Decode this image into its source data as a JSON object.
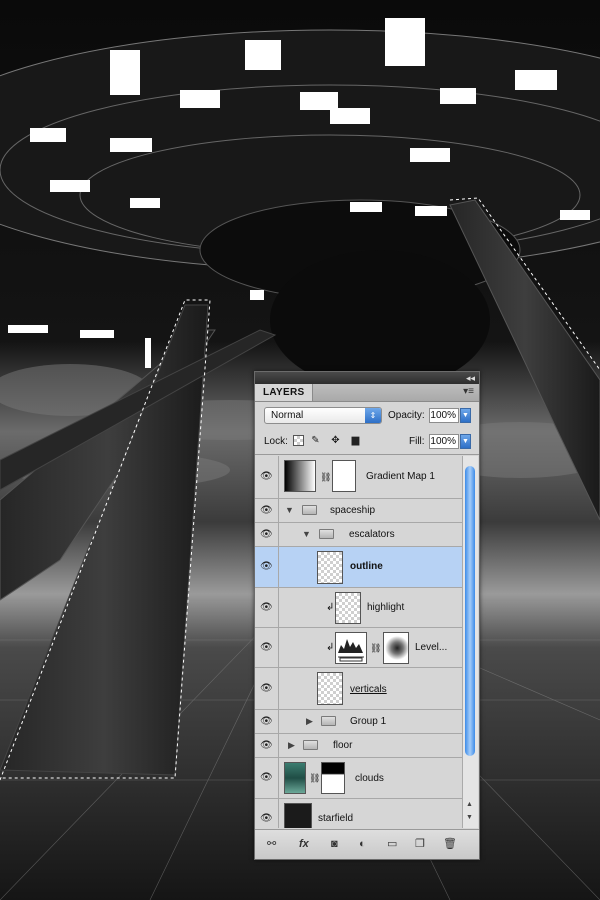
{
  "panel": {
    "tab_label": "LAYERS",
    "collapse_glyph": "◂◂",
    "menu_glyph": "▾≡",
    "blend_mode": "Normal",
    "opacity_label": "Opacity:",
    "opacity_value": "100%",
    "lock_label": "Lock:",
    "fill_label": "Fill:",
    "fill_value": "100%",
    "lock_icons": [
      "lock-transparent-icon",
      "lock-brush-icon",
      "lock-move-icon",
      "lock-all-icon"
    ]
  },
  "layers": [
    {
      "name": "Gradient Map 1",
      "kind": "adjustment",
      "selected": false
    },
    {
      "name": "spaceship",
      "kind": "group",
      "expanded": true,
      "selected": false
    },
    {
      "name": "escalators",
      "kind": "group",
      "expanded": true,
      "selected": false
    },
    {
      "name": "outline",
      "kind": "layer",
      "selected": true
    },
    {
      "name": "highlight",
      "kind": "layer",
      "clipped": true,
      "selected": false
    },
    {
      "name": "Level...",
      "kind": "adjustment",
      "clipped": true,
      "selected": false
    },
    {
      "name": "verticals",
      "kind": "layer",
      "selected": false
    },
    {
      "name": "Group 1",
      "kind": "group",
      "expanded": false,
      "selected": false
    },
    {
      "name": "floor",
      "kind": "group",
      "expanded": false,
      "selected": false
    },
    {
      "name": "clouds",
      "kind": "layer",
      "selected": false
    },
    {
      "name": "starfield",
      "kind": "layer",
      "selected": false
    }
  ],
  "footer_icons": [
    "link-layers-icon",
    "fx-icon",
    "add-mask-icon",
    "adjustment-layer-icon",
    "new-group-icon",
    "new-layer-icon",
    "trash-icon"
  ],
  "colors": {
    "selection": "#b7d2f4",
    "accent": "#2d6fc7",
    "panel": "#d6d6d6"
  }
}
